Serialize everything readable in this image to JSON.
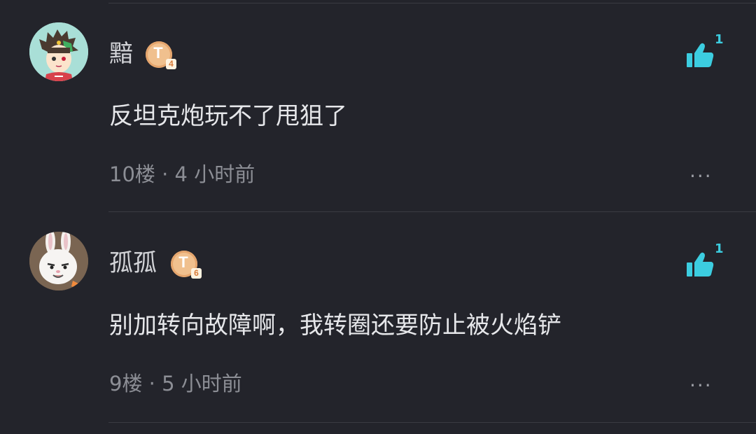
{
  "comments": [
    {
      "username": "黯",
      "badge_text": "T",
      "badge_level": "4",
      "text": "反坦克炮玩不了甩狙了",
      "meta": "10楼 · 4 小时前",
      "likes": "1",
      "more": "···",
      "avatar": "anime-boy-avatar"
    },
    {
      "username": "孤孤",
      "badge_text": "T",
      "badge_level": "6",
      "text": "别加转向故障啊，我转圈还要防止被火焰铲",
      "meta": "9楼 · 5 小时前",
      "likes": "1",
      "more": "···",
      "avatar": "bunny-avatar"
    }
  ],
  "colors": {
    "background": "#23242b",
    "accent": "#3ccde0",
    "badge": "#f0c08e"
  }
}
